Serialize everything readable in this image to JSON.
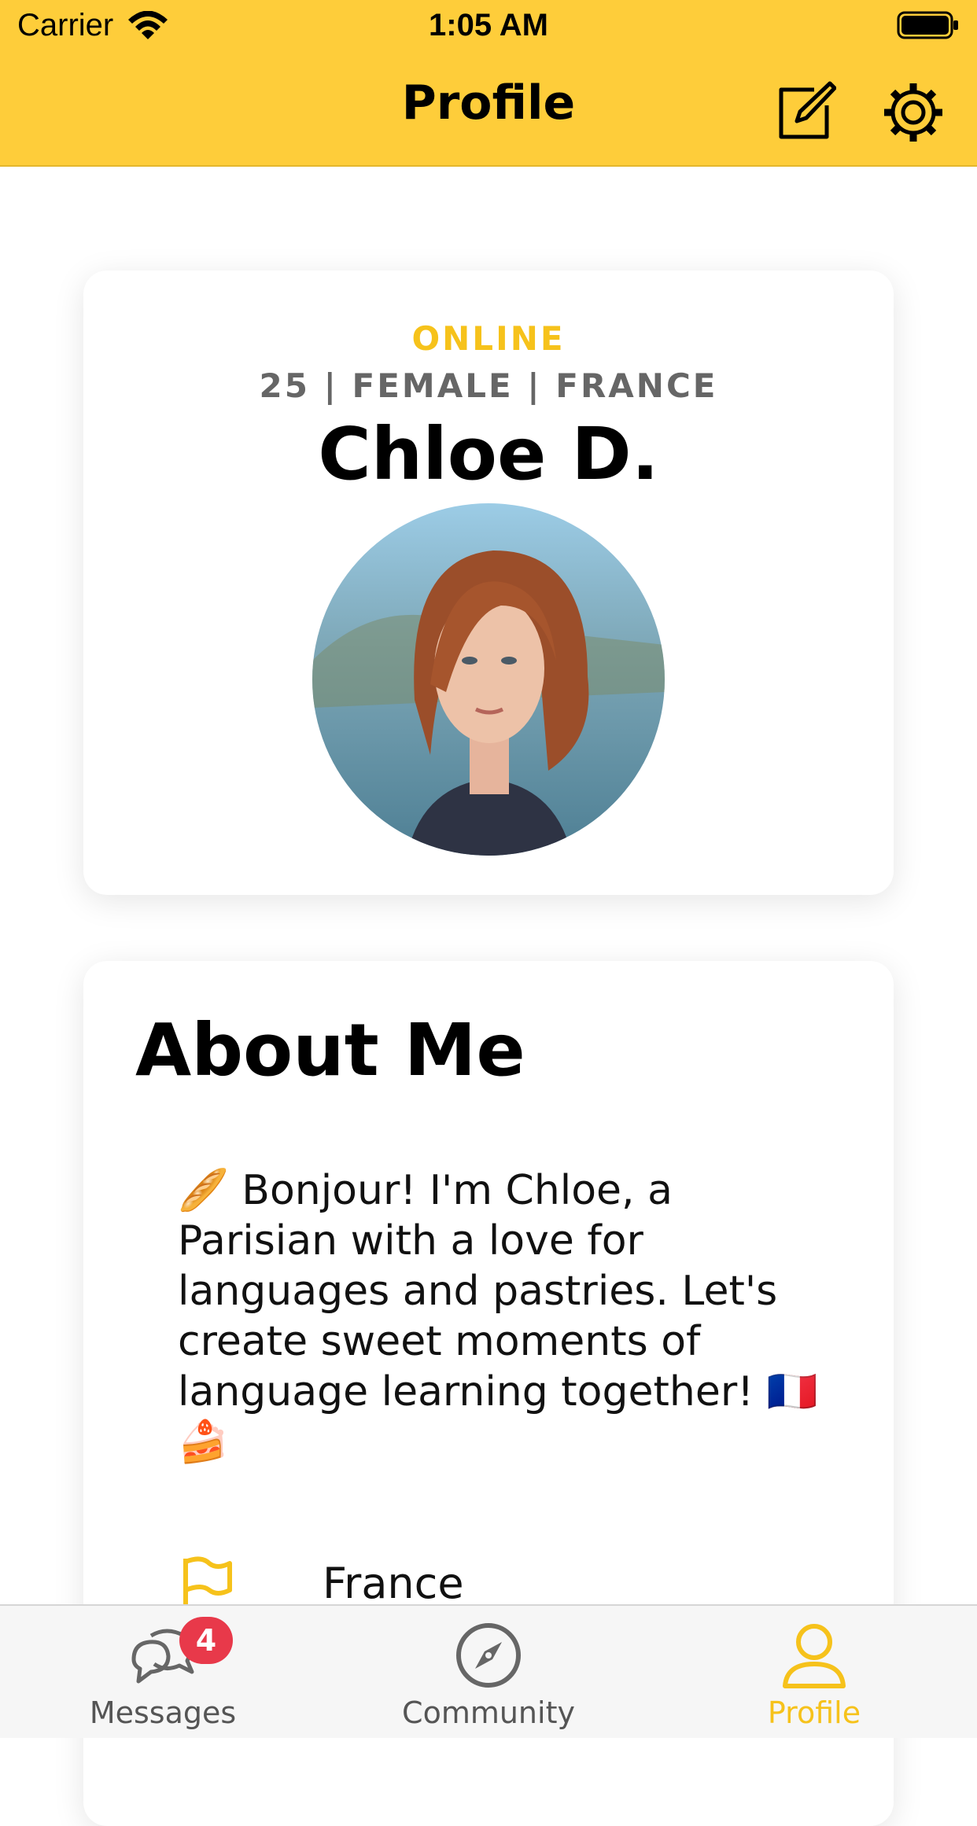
{
  "status_bar": {
    "carrier": "Carrier",
    "time": "1:05 AM"
  },
  "nav": {
    "title": "Profile"
  },
  "profile": {
    "status": "ONLINE",
    "meta": "25 | FEMALE | FRANCE",
    "name": "Chloe D."
  },
  "about": {
    "title": "About Me",
    "bio": "🥖 Bonjour! I'm Chloe, a Parisian with a love for languages and pastries. Let's create sweet moments of language learning together! 🇫🇷🍰",
    "country": "France"
  },
  "tabs": [
    {
      "label": "Messages",
      "icon": "chat-bubbles-icon",
      "badge": "4"
    },
    {
      "label": "Community",
      "icon": "compass-icon"
    },
    {
      "label": "Profile",
      "icon": "person-icon",
      "active": true
    }
  ],
  "colors": {
    "accent": "#fecd3a",
    "active": "#f6c21b",
    "badge": "#e8394a"
  }
}
